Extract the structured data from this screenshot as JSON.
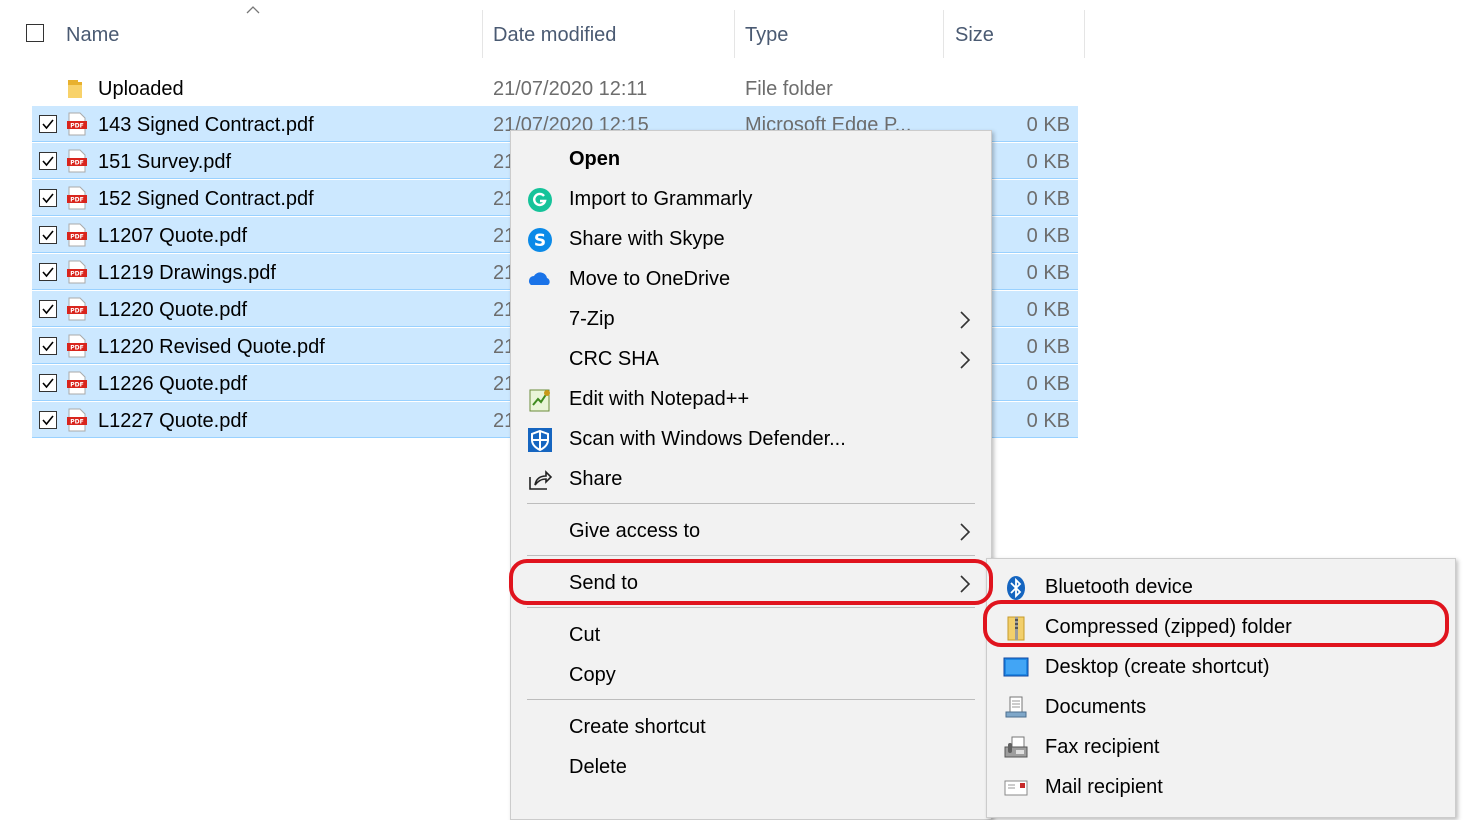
{
  "header": {
    "columns": [
      "Name",
      "Date modified",
      "Type",
      "Size"
    ]
  },
  "files": [
    {
      "name": "Uploaded",
      "date": "21/07/2020 12:11",
      "type": "File folder",
      "size": "",
      "icon": "folder-icon",
      "selected": false
    },
    {
      "name": "143 Signed Contract.pdf",
      "date": "21/07/2020 12:15",
      "type": "Microsoft Edge P...",
      "size": "0 KB",
      "icon": "pdf-icon",
      "selected": true
    },
    {
      "name": "151 Survey.pdf",
      "date": "21",
      "type": "",
      "size": "0 KB",
      "icon": "pdf-icon",
      "selected": true
    },
    {
      "name": "152 Signed Contract.pdf",
      "date": "21",
      "type": "",
      "size": "0 KB",
      "icon": "pdf-icon",
      "selected": true
    },
    {
      "name": "L1207 Quote.pdf",
      "date": "21",
      "type": "",
      "size": "0 KB",
      "icon": "pdf-icon",
      "selected": true
    },
    {
      "name": "L1219 Drawings.pdf",
      "date": "21",
      "type": "",
      "size": "0 KB",
      "icon": "pdf-icon",
      "selected": true
    },
    {
      "name": "L1220 Quote.pdf",
      "date": "21",
      "type": "",
      "size": "0 KB",
      "icon": "pdf-icon",
      "selected": true
    },
    {
      "name": "L1220 Revised Quote.pdf",
      "date": "21",
      "type": "",
      "size": "0 KB",
      "icon": "pdf-icon",
      "selected": true
    },
    {
      "name": "L1226 Quote.pdf",
      "date": "21",
      "type": "",
      "size": "0 KB",
      "icon": "pdf-icon",
      "selected": true
    },
    {
      "name": "L1227 Quote.pdf",
      "date": "21",
      "type": "",
      "size": "0 KB",
      "icon": "pdf-icon",
      "selected": true
    }
  ],
  "context_menu": {
    "items": [
      {
        "label": "Open",
        "bold": true,
        "icon": "",
        "submenu": false
      },
      {
        "label": "Import to Grammarly",
        "icon": "grammarly-icon",
        "submenu": false
      },
      {
        "label": "Share with Skype",
        "icon": "skype-icon",
        "submenu": false
      },
      {
        "label": "Move to OneDrive",
        "icon": "onedrive-icon",
        "submenu": false
      },
      {
        "label": "7-Zip",
        "icon": "",
        "submenu": true
      },
      {
        "label": "CRC SHA",
        "icon": "",
        "submenu": true
      },
      {
        "label": "Edit with Notepad++",
        "icon": "notepad-plus-plus-icon",
        "submenu": false
      },
      {
        "label": "Scan with Windows Defender...",
        "icon": "windows-defender-icon",
        "submenu": false
      },
      {
        "label": "Share",
        "icon": "share-icon",
        "submenu": false
      },
      {
        "label": "Give access to",
        "icon": "",
        "submenu": true
      },
      {
        "label": "Send to",
        "icon": "",
        "submenu": true,
        "highlighted": true
      },
      {
        "label": "Cut",
        "icon": "",
        "submenu": false
      },
      {
        "label": "Copy",
        "icon": "",
        "submenu": false
      },
      {
        "label": "Create shortcut",
        "icon": "",
        "submenu": false
      },
      {
        "label": "Delete",
        "icon": "",
        "submenu": false
      }
    ]
  },
  "send_to_menu": {
    "items": [
      {
        "label": "Bluetooth device",
        "icon": "bluetooth-icon"
      },
      {
        "label": "Compressed (zipped) folder",
        "icon": "zip-folder-icon",
        "highlighted": true
      },
      {
        "label": "Desktop (create shortcut)",
        "icon": "desktop-icon"
      },
      {
        "label": "Documents",
        "icon": "documents-icon"
      },
      {
        "label": "Fax recipient",
        "icon": "fax-icon"
      },
      {
        "label": "Mail recipient",
        "icon": "mail-icon"
      }
    ]
  },
  "colors": {
    "selection": "#cce8ff",
    "menu_bg": "#f2f2f2",
    "highlight_ring": "#e0141e"
  }
}
